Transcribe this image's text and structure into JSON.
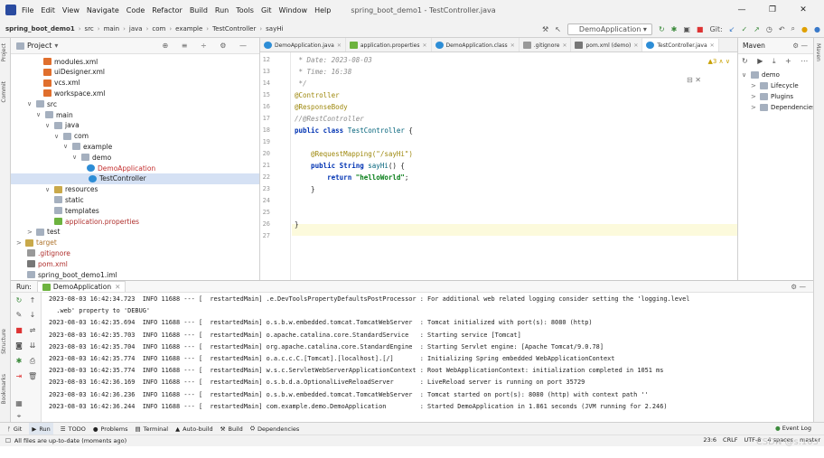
{
  "menu": {
    "items": [
      "File",
      "Edit",
      "View",
      "Navigate",
      "Code",
      "Refactor",
      "Build",
      "Run",
      "Tools",
      "Git",
      "Window",
      "Help"
    ],
    "window_title": "spring_boot_demo1 - TestController.java",
    "controls": [
      "—",
      "❐",
      "✕"
    ]
  },
  "navbar": {
    "breadcrumbs": [
      "spring_boot_demo1",
      "src",
      "main",
      "java",
      "com",
      "example",
      "TestController",
      "sayHi"
    ],
    "run_config": "DemoApplication",
    "git_label": "Git:"
  },
  "left_strip": {
    "project": "Project",
    "commit": "Commit",
    "structure": "Structure",
    "bookmarks": "Bookmarks"
  },
  "right_strip": {
    "maven": "Maven"
  },
  "project": {
    "title": "Project",
    "items": [
      {
        "label": "modules.xml",
        "icon": "xml",
        "arrow": ""
      },
      {
        "label": "uiDesigner.xml",
        "icon": "xml",
        "arrow": ""
      },
      {
        "label": "vcs.xml",
        "icon": "xml",
        "arrow": ""
      },
      {
        "label": "workspace.xml",
        "icon": "xml",
        "arrow": ""
      },
      {
        "label": "src",
        "icon": "folder",
        "arrow": "∨"
      },
      {
        "label": "main",
        "icon": "folder",
        "arrow": "∨"
      },
      {
        "label": "java",
        "icon": "folder",
        "arrow": "∨"
      },
      {
        "label": "com",
        "icon": "folder",
        "arrow": "∨"
      },
      {
        "label": "example",
        "icon": "folder",
        "arrow": "∨"
      },
      {
        "label": "demo",
        "icon": "folder",
        "arrow": "∨"
      },
      {
        "label": "DemoApplication",
        "icon": "java",
        "arrow": ""
      },
      {
        "label": "TestController",
        "icon": "java",
        "arrow": ""
      },
      {
        "label": "resources",
        "icon": "res",
        "arrow": "∨"
      },
      {
        "label": "static",
        "icon": "folder",
        "arrow": ""
      },
      {
        "label": "templates",
        "icon": "folder",
        "arrow": ""
      },
      {
        "label": "application.properties",
        "icon": "spring",
        "arrow": ""
      },
      {
        "label": "test",
        "icon": "folder",
        "arrow": ">"
      },
      {
        "label": "target",
        "icon": "res",
        "arrow": ">"
      },
      {
        "label": ".gitignore",
        "icon": "git",
        "arrow": ""
      },
      {
        "label": "pom.xml",
        "icon": "m",
        "arrow": ""
      },
      {
        "label": "spring_boot_demo1.iml",
        "icon": "folder",
        "arrow": ""
      }
    ]
  },
  "editor": {
    "tabs": [
      {
        "label": "DemoApplication.java",
        "icon": "java"
      },
      {
        "label": "application.properties",
        "icon": "spring"
      },
      {
        "label": "DemoApplication.class",
        "icon": "java"
      },
      {
        "label": ".gitignore",
        "icon": "git"
      },
      {
        "label": "pom.xml (demo)",
        "icon": "m"
      },
      {
        "label": "TestController.java",
        "icon": "java",
        "active": true
      }
    ],
    "line_numbers": [
      "12",
      "13",
      "14",
      "15",
      "16",
      "17",
      "18",
      "19",
      "20",
      "21",
      "22",
      "23",
      "24",
      "25",
      "26",
      "27"
    ],
    "inspection": "▲3 ∧ ∨",
    "lines": [
      {
        "n": "12",
        "parts": [
          {
            "t": " * Date: 2023-08-03",
            "c": "cmt"
          }
        ]
      },
      {
        "n": "13",
        "parts": [
          {
            "t": " * Time: 16:38",
            "c": "cmt"
          }
        ]
      },
      {
        "n": "14",
        "parts": [
          {
            "t": " */",
            "c": "cmt"
          }
        ]
      },
      {
        "n": "15",
        "parts": [
          {
            "t": "@Controller",
            "c": "ann"
          }
        ]
      },
      {
        "n": "16",
        "parts": [
          {
            "t": "@ResponseBody",
            "c": "ann"
          }
        ]
      },
      {
        "n": "17",
        "parts": [
          {
            "t": "//@RestController",
            "c": "cmt"
          }
        ]
      },
      {
        "n": "18",
        "parts": [
          {
            "t": "public class ",
            "c": "kw"
          },
          {
            "t": "TestController",
            "c": "nm"
          },
          {
            "t": " {",
            "c": ""
          }
        ]
      },
      {
        "n": "19",
        "parts": []
      },
      {
        "n": "20",
        "parts": [
          {
            "t": "    @RequestMapping(\"/sayHi\")",
            "c": "ann"
          }
        ]
      },
      {
        "n": "21",
        "parts": [
          {
            "t": "    public String ",
            "c": "kw"
          },
          {
            "t": "sayHi",
            "c": "nm"
          },
          {
            "t": "() {",
            "c": ""
          }
        ]
      },
      {
        "n": "22",
        "parts": [
          {
            "t": "        return ",
            "c": "kw"
          },
          {
            "t": "\"helloWorld\"",
            "c": "str"
          },
          {
            "t": ";",
            "c": ""
          }
        ]
      },
      {
        "n": "23",
        "parts": [
          {
            "t": "    }",
            "c": ""
          }
        ]
      },
      {
        "n": "24",
        "parts": []
      },
      {
        "n": "25",
        "parts": []
      },
      {
        "n": "26",
        "parts": [
          {
            "t": "}",
            "c": ""
          }
        ]
      },
      {
        "n": "27",
        "parts": []
      }
    ]
  },
  "maven": {
    "title": "Maven",
    "tree": [
      {
        "label": "demo",
        "arrow": "∨"
      },
      {
        "label": "Lifecycle",
        "arrow": ">"
      },
      {
        "label": "Plugins",
        "arrow": ">"
      },
      {
        "label": "Dependencies",
        "arrow": ">"
      }
    ]
  },
  "run": {
    "label": "Run:",
    "tab": "DemoApplication",
    "lines": [
      "2023-08-03 16:42:34.723  INFO 11688 --- [  restartedMain] .e.DevToolsPropertyDefaultsPostProcessor : For additional web related logging consider setting the 'logging.level",
      "  .web' property to 'DEBUG'",
      "2023-08-03 16:42:35.694  INFO 11688 --- [  restartedMain] o.s.b.w.embedded.tomcat.TomcatWebServer  : Tomcat initialized with port(s): 8080 (http)",
      "2023-08-03 16:42:35.703  INFO 11688 --- [  restartedMain] o.apache.catalina.core.StandardService   : Starting service [Tomcat]",
      "2023-08-03 16:42:35.704  INFO 11688 --- [  restartedMain] org.apache.catalina.core.StandardEngine  : Starting Servlet engine: [Apache Tomcat/9.0.78]",
      "2023-08-03 16:42:35.774  INFO 11688 --- [  restartedMain] o.a.c.c.C.[Tomcat].[localhost].[/]       : Initializing Spring embedded WebApplicationContext",
      "2023-08-03 16:42:35.774  INFO 11688 --- [  restartedMain] w.s.c.ServletWebServerApplicationContext : Root WebApplicationContext: initialization completed in 1051 ms",
      "2023-08-03 16:42:36.169  INFO 11688 --- [  restartedMain] o.s.b.d.a.OptionalLiveReloadServer       : LiveReload server is running on port 35729",
      "2023-08-03 16:42:36.236  INFO 11688 --- [  restartedMain] o.s.b.w.embedded.tomcat.TomcatWebServer  : Tomcat started on port(s): 8080 (http) with context path ''",
      "2023-08-03 16:42:36.244  INFO 11688 --- [  restartedMain] com.example.demo.DemoApplication         : Started DemoApplication in 1.861 seconds (JVM running for 2.246)"
    ]
  },
  "bottom_tabs": [
    {
      "label": "Git",
      "icon": "ᚠ"
    },
    {
      "label": "Run",
      "icon": "▶",
      "active": true
    },
    {
      "label": "TODO",
      "icon": "☰"
    },
    {
      "label": "Problems",
      "icon": "●"
    },
    {
      "label": "Terminal",
      "icon": "▤"
    },
    {
      "label": "Auto-build",
      "icon": "▲"
    },
    {
      "label": "Build",
      "icon": "⚒"
    },
    {
      "label": "Dependencies",
      "icon": "⛭"
    }
  ],
  "event_log": "Event Log",
  "status": {
    "message": "All files are up-to-date (moments ago)",
    "position": "23:6",
    "line_sep": "CRLF",
    "encoding": "UTF-8",
    "indent": "4 spaces",
    "branch": "master"
  },
  "watermark": "CSDN @s.103",
  "colors": {
    "accent": "#4a88c7",
    "selection": "#d5e1f4",
    "current_line": "#fcfadc",
    "annotation": "#9e880d",
    "keyword": "#0033b3",
    "string": "#067d17"
  }
}
